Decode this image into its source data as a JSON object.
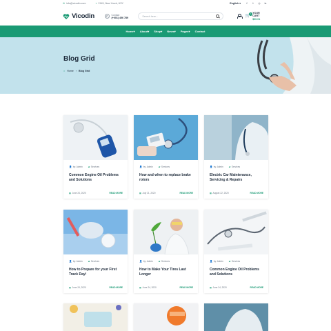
{
  "topbar": {
    "email": "info@vicodin.com",
    "address": "2145, New Yourk, USY",
    "language": "English",
    "social_icons": [
      "facebook-icon",
      "twitter-icon",
      "instagram-icon",
      "linkedin-icon"
    ]
  },
  "header": {
    "logo_text": "Vicodin",
    "contact_label": "Contact",
    "contact_phone": "(+001) 456 789",
    "search_placeholder": "Search here...",
    "cart_label": "YOUR CART",
    "cart_amount": "$00.01",
    "cart_count": "1"
  },
  "nav": {
    "items": [
      {
        "label": "Home"
      },
      {
        "label": "About"
      },
      {
        "label": "Shop"
      },
      {
        "label": "News"
      },
      {
        "label": "Pages"
      },
      {
        "label": "Contact"
      }
    ]
  },
  "hero": {
    "title": "Blog Grid",
    "crumb_home": "Home",
    "crumb_current": "Blog Grid"
  },
  "blog": {
    "author": "by: Admin",
    "category": "Services",
    "read_more": "READ MORE",
    "posts": [
      {
        "title": "Common Engine Oil Problems and Solutions",
        "date": "June 24, 2020"
      },
      {
        "title": "How and when to replace brake rotors",
        "date": "July 21, 2020"
      },
      {
        "title": "Electric Car Maintenance, Servicing & Repairs",
        "date": "August 22, 2020"
      },
      {
        "title": "How to Prepare for your First Track Day!",
        "date": "June 24, 2020"
      },
      {
        "title": "How to Make Your Tires Last Longer",
        "date": "June 24, 2020"
      },
      {
        "title": "Common Engine Oil Problems and Solutions",
        "date": "June 24, 2020"
      }
    ]
  },
  "colors": {
    "accent": "#1a9a74",
    "hero_bg": "#c2e2ec",
    "text_dark": "#1d2a3a"
  }
}
